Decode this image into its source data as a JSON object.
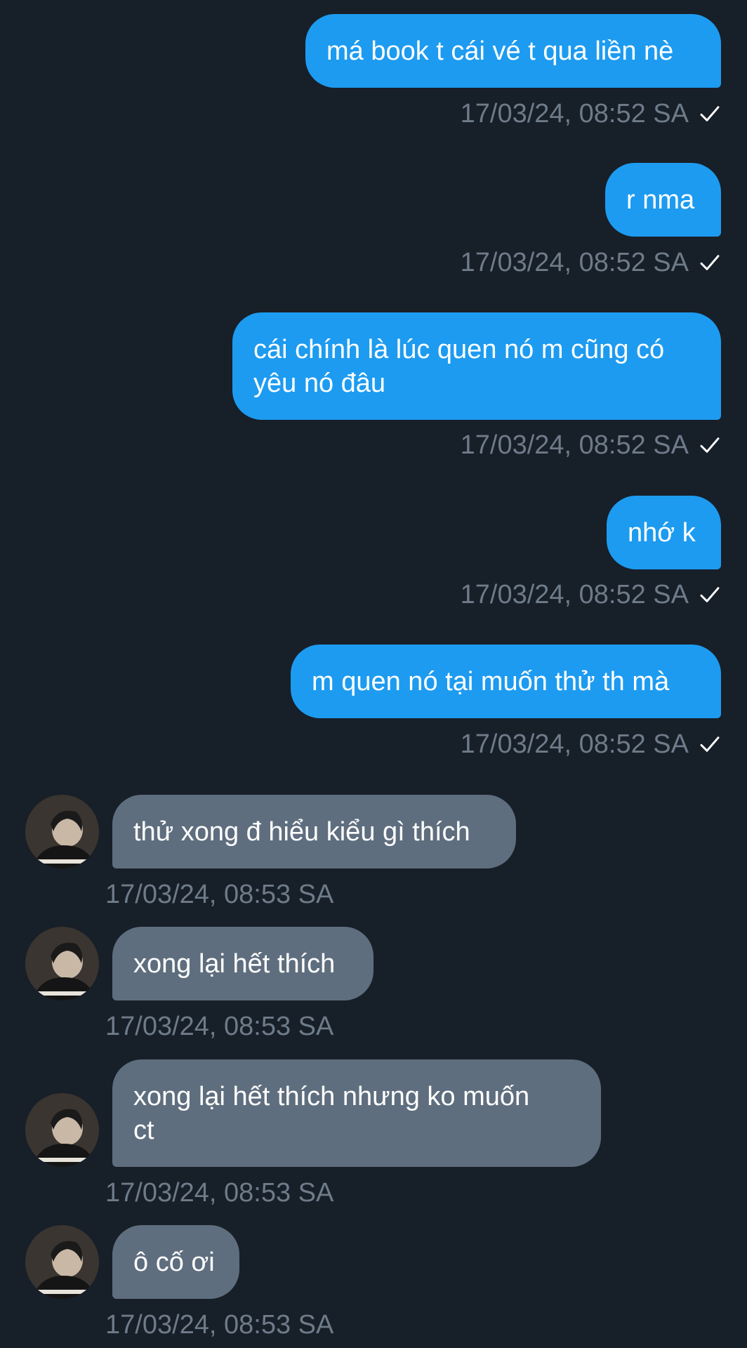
{
  "conversation": {
    "messages": [
      {
        "direction": "out",
        "text": "má book t cái vé t qua liền nè",
        "time": "17/03/24, 08:52 SA",
        "status": "sent"
      },
      {
        "direction": "out",
        "text": "r nma",
        "time": "17/03/24, 08:52 SA",
        "status": "sent"
      },
      {
        "direction": "out",
        "text": "cái chính là lúc quen nó m cũng có\nyêu nó đâu",
        "time": "17/03/24, 08:52 SA",
        "status": "sent"
      },
      {
        "direction": "out",
        "text": "nhớ k",
        "time": "17/03/24, 08:52 SA",
        "status": "sent"
      },
      {
        "direction": "out",
        "text": "m quen nó tại muốn thử th mà",
        "time": "17/03/24, 08:52 SA",
        "status": "sent"
      },
      {
        "direction": "in",
        "text": "thử xong đ hiểu kiểu gì thích",
        "time": "17/03/24, 08:53 SA",
        "avatar": "user-avatar"
      },
      {
        "direction": "in",
        "text": "xong lại hết thích",
        "time": "17/03/24, 08:53 SA",
        "avatar": "user-avatar"
      },
      {
        "direction": "in",
        "text": "xong lại hết thích nhưng ko muốn\nct",
        "time": "17/03/24, 08:53 SA",
        "avatar": "user-avatar"
      },
      {
        "direction": "in",
        "text": "ô cố ơi",
        "time": "17/03/24, 08:53 SA",
        "avatar": "user-avatar"
      }
    ]
  },
  "colors": {
    "background": "#171f29",
    "outgoing_bubble": "#1d9bf0",
    "incoming_bubble": "#5f6e7e",
    "timestamp": "#6e7b89",
    "text": "#ffffff"
  },
  "icons": {
    "sent_status": "checkmark-icon"
  }
}
